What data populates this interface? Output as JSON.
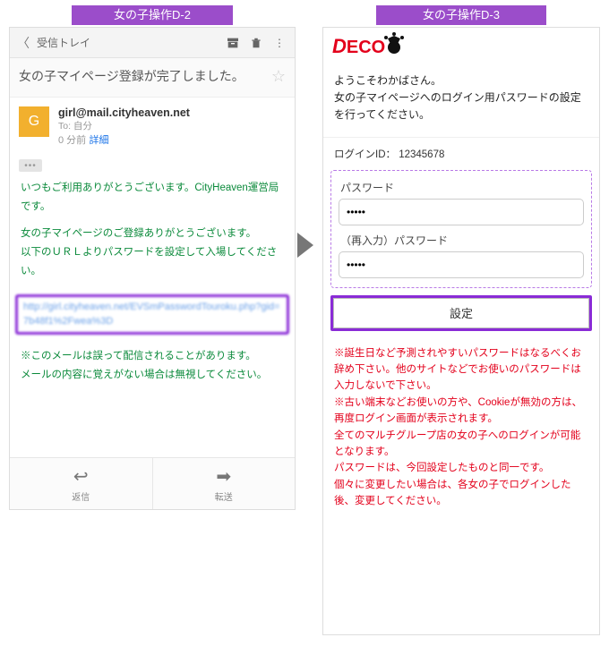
{
  "titles": {
    "left": "女の子操作D-2",
    "right": "女の子操作D-3"
  },
  "mail": {
    "inbox_label": "受信トレイ",
    "subject": "女の子マイページ登録が完了しました。",
    "from": "girl@mail.cityheaven.net",
    "to_line": "To: 自分",
    "time": "0 分前",
    "detail_link": "詳細",
    "body": {
      "p1": "いつもご利用ありがとうございます。CityHeaven運営局です。",
      "p2a": "女の子マイページのご登録ありがとうございます。",
      "p2b": "以下のＵＲＬよりパスワードを設定して入場してください。",
      "url": "http://girl.cityheaven.net/EVSmPasswordTouroku.php?gid=7b48f1%2Fwea%3D",
      "p3a": "※このメールは誤って配信されることがあります。",
      "p3b": "メールの内容に覚えがない場合は無視してください。"
    },
    "reply_label": "返信",
    "forward_label": "転送"
  },
  "setup": {
    "logo_text": {
      "d": "D",
      "eco": "ECO"
    },
    "welcome_l1": "ようこそわかばさん。",
    "welcome_l2": "女の子マイページへのログイン用パスワードの設定を行ってください。",
    "login_id_label": "ログインID：",
    "login_id_value": "12345678",
    "pw_label": "パスワード",
    "pw_value": "•••••",
    "pw2_label": "（再入力）パスワード",
    "pw2_value": "•••••",
    "submit_label": "設定",
    "notes": {
      "n1": "※誕生日など予測されやすいパスワードはなるべくお辞め下さい。他のサイトなどでお使いのパスワードは入力しないで下さい。",
      "n2": "※古い端末などお使いの方や、Cookieが無効の方は、再度ログイン画面が表示されます。",
      "n3": "全てのマルチグループ店の女の子へのログインが可能となります。",
      "n4": "パスワードは、今回設定したものと同一です。",
      "n5": "個々に変更したい場合は、各女の子でログインした後、変更してください。"
    }
  }
}
